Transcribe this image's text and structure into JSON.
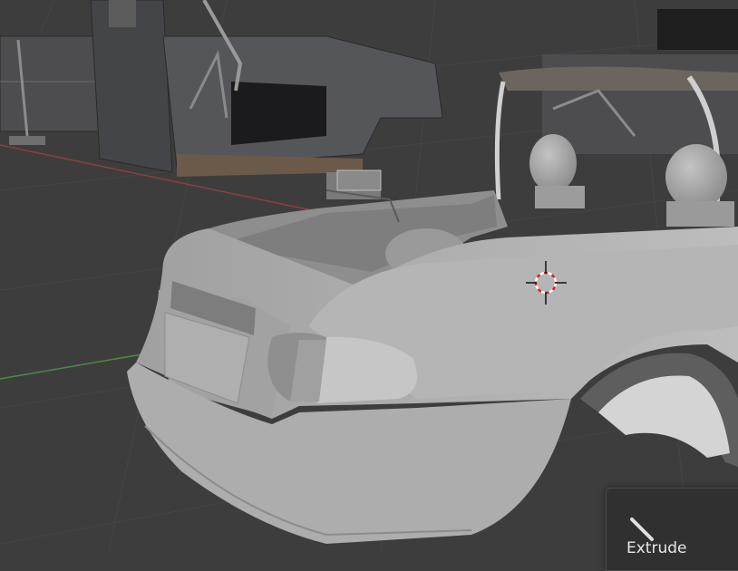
{
  "app": "Blender",
  "viewport": {
    "background": "#3d3d3d",
    "grid_color": "#464646",
    "x_axis_color": "#8a4040",
    "y_axis_color": "#4a8a4a",
    "cursor": "3d-cursor-icon",
    "model_color": "#a9a9a9"
  },
  "operator_panel": {
    "title": "Extrude",
    "icon": "collapse-arrow-icon"
  }
}
